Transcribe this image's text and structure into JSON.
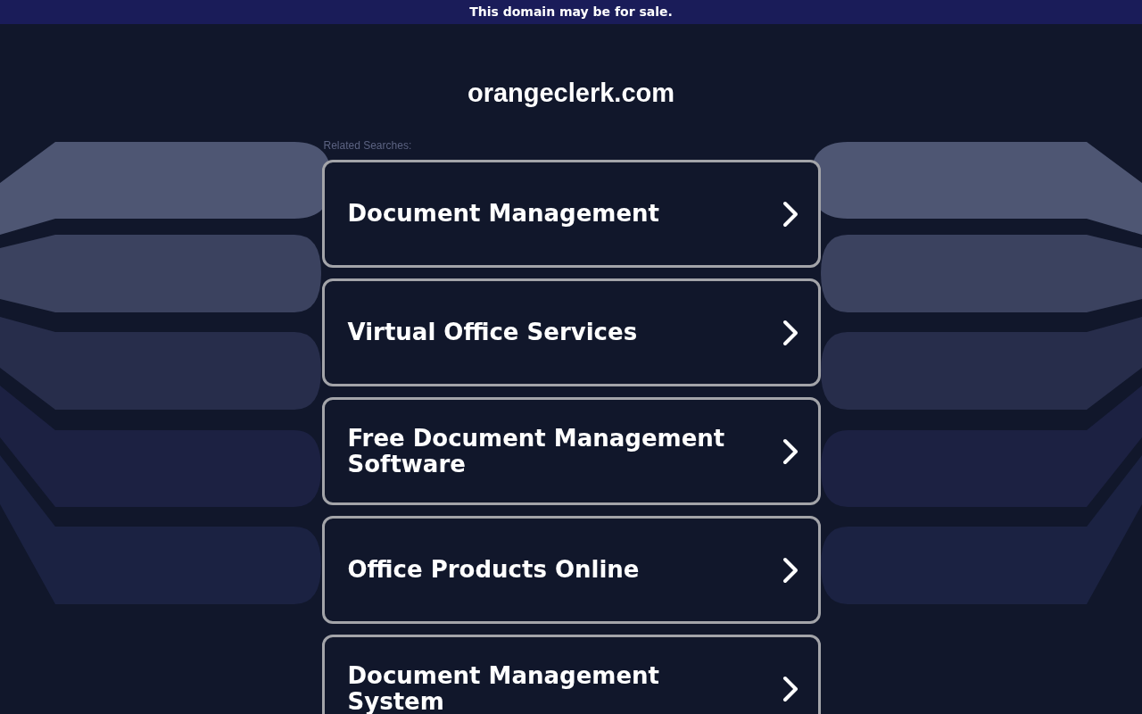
{
  "banner": {
    "text": "This domain may be for sale."
  },
  "domain": {
    "title": "orangeclerk.com"
  },
  "related": {
    "label": "Related Searches:",
    "links": [
      {
        "text": "Document Management"
      },
      {
        "text": "Virtual Office Services"
      },
      {
        "text": "Free Document Management Software"
      },
      {
        "text": "Office Products Online"
      },
      {
        "text": "Document Management System"
      }
    ]
  }
}
